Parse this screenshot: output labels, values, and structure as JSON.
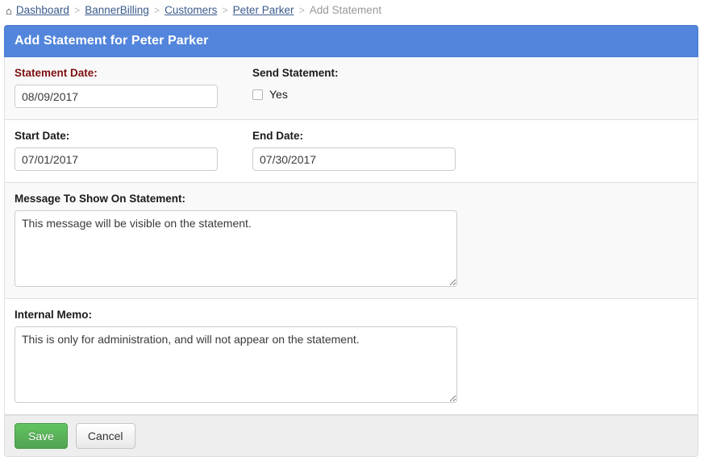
{
  "breadcrumb": {
    "home_icon": "home-icon",
    "items": [
      {
        "label": "Dashboard",
        "current": false
      },
      {
        "label": "BannerBilling",
        "current": false
      },
      {
        "label": "Customers",
        "current": false
      },
      {
        "label": "Peter Parker",
        "current": false
      },
      {
        "label": "Add Statement",
        "current": true
      }
    ],
    "separator": ">"
  },
  "panel": {
    "title": "Add Statement for Peter Parker",
    "header_color": "#5285db"
  },
  "form": {
    "statement_date": {
      "label": "Statement Date:",
      "value": "08/09/2017",
      "placeholder": "",
      "required_color": "#7d1010"
    },
    "send_statement": {
      "label": "Send Statement:",
      "checkbox_label": "Yes",
      "checked": false
    },
    "start_date": {
      "label": "Start Date:",
      "value": "07/01/2017",
      "placeholder": ""
    },
    "end_date": {
      "label": "End Date:",
      "value": "07/30/2017",
      "placeholder": ""
    },
    "message": {
      "label": "Message To Show On Statement:",
      "value": "This message will be visible on the statement.",
      "placeholder": ""
    },
    "internal_memo": {
      "label": "Internal Memo:",
      "value": "This is only for administration, and will not appear on the statement.",
      "placeholder": ""
    }
  },
  "footer": {
    "save_label": "Save",
    "cancel_label": "Cancel",
    "save_color": "#51a351"
  }
}
